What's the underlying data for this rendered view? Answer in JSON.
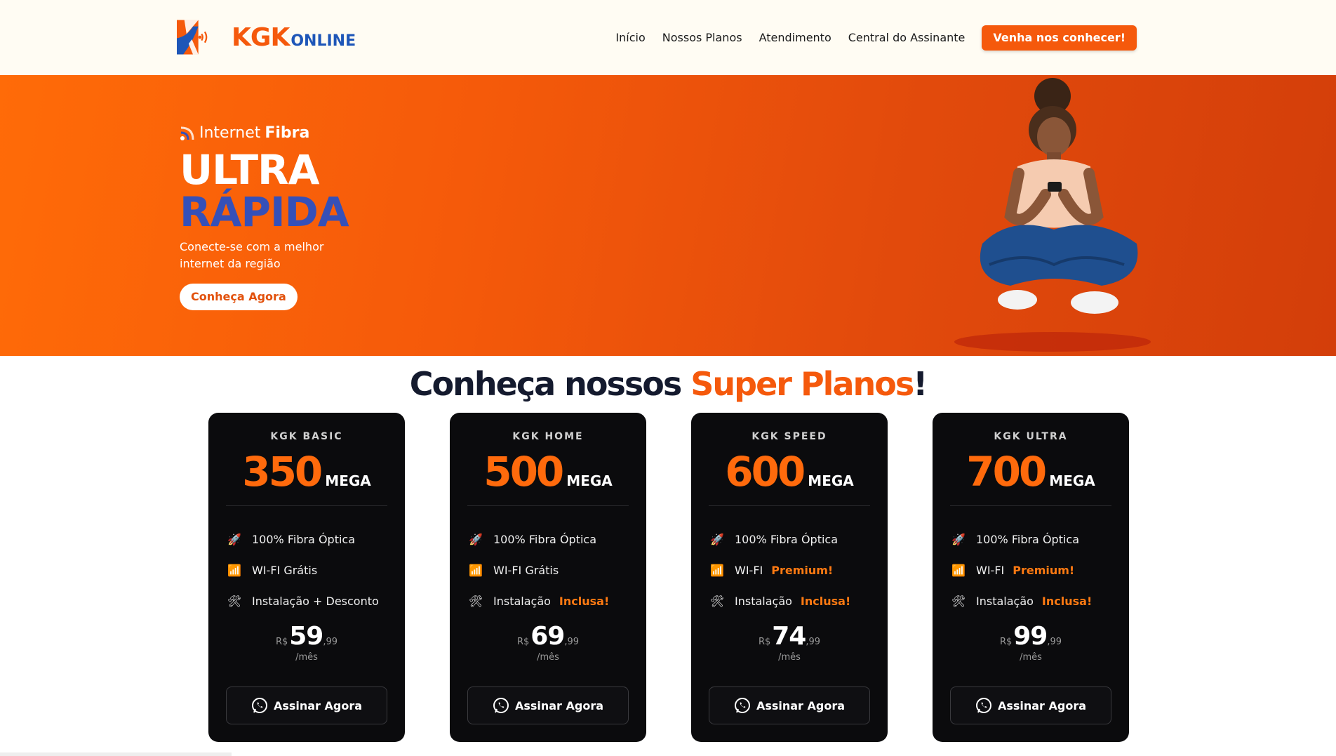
{
  "header": {
    "logo": {
      "brand": "KGK",
      "suffix": "ONLINE"
    },
    "nav": [
      {
        "label": "Início"
      },
      {
        "label": "Nossos Planos"
      },
      {
        "label": "Atendimento"
      },
      {
        "label": "Central do Assinante"
      }
    ],
    "cta_label": "Venha nos conhecer!"
  },
  "hero": {
    "tag_prefix": "Internet",
    "tag_bold": "Fibra",
    "title_line1": "ULTRA",
    "title_line2": "RÁPIDA",
    "subtitle": "Conecte-se com a melhor internet da região",
    "button_label": "Conheça Agora"
  },
  "section": {
    "title_prefix": "Conheça nossos",
    "title_highlight": "Super Planos",
    "title_suffix": "!"
  },
  "plans": [
    {
      "name": "KGK BASIC",
      "speed": "350",
      "unit": "MEGA",
      "features": [
        {
          "text": "100% Fibra Óptica",
          "highlight": ""
        },
        {
          "text": "WI-FI Grátis",
          "highlight": ""
        },
        {
          "text": "Instalação + Desconto",
          "highlight": ""
        }
      ],
      "currency": "R$",
      "price_int": "59",
      "price_dec": ",99",
      "period": "/mês",
      "button_label": "Assinar Agora"
    },
    {
      "name": "KGK HOME",
      "speed": "500",
      "unit": "MEGA",
      "features": [
        {
          "text": "100% Fibra Óptica",
          "highlight": ""
        },
        {
          "text": "WI-FI Grátis",
          "highlight": ""
        },
        {
          "text": "Instalação",
          "highlight": "Inclusa!"
        }
      ],
      "currency": "R$",
      "price_int": "69",
      "price_dec": ",99",
      "period": "/mês",
      "button_label": "Assinar Agora"
    },
    {
      "name": "KGK SPEED",
      "speed": "600",
      "unit": "MEGA",
      "features": [
        {
          "text": "100% Fibra Óptica",
          "highlight": ""
        },
        {
          "text": "WI-FI",
          "highlight": "Premium!"
        },
        {
          "text": "Instalação",
          "highlight": "Inclusa!"
        }
      ],
      "currency": "R$",
      "price_int": "74",
      "price_dec": ",99",
      "period": "/mês",
      "button_label": "Assinar Agora"
    },
    {
      "name": "KGK ULTRA",
      "speed": "700",
      "unit": "MEGA",
      "features": [
        {
          "text": "100% Fibra Óptica",
          "highlight": ""
        },
        {
          "text": "WI-FI",
          "highlight": "Premium!"
        },
        {
          "text": "Instalação",
          "highlight": "Inclusa!"
        }
      ],
      "currency": "R$",
      "price_int": "99",
      "price_dec": ",99",
      "period": "/mês",
      "button_label": "Assinar Agora"
    }
  ],
  "feature_icons": [
    "rocket-icon",
    "wifi-icon",
    "tools-icon"
  ],
  "colors": {
    "brand_orange": "#f5590c",
    "brand_blue": "#1e56b8",
    "card_bg": "#0b0b0d"
  }
}
